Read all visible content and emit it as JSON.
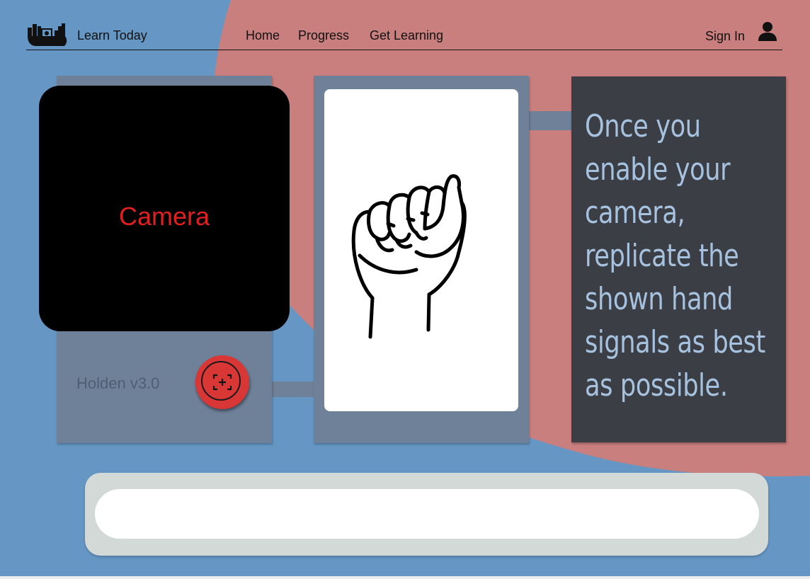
{
  "header": {
    "brand": "Learn Today",
    "nav": {
      "home": "Home",
      "progress": "Progress",
      "get_learning": "Get Learning"
    },
    "sign_in": "Sign In"
  },
  "camera": {
    "label": "Camera",
    "version": "Holden v3.0",
    "capture_icon": "capture-focus-icon"
  },
  "instruction": "Once you enable your camera, replicate the shown hand signals as best as possible.",
  "input": {
    "value": "",
    "placeholder": ""
  },
  "colors": {
    "background_blue": "#6596c4",
    "background_red": "#c97f7d",
    "panel": "#6f8199",
    "instruction_panel": "#3b3e44",
    "instruction_text": "#a6c2df",
    "camera_label": "#e02020",
    "capture_button": "#d93636"
  }
}
